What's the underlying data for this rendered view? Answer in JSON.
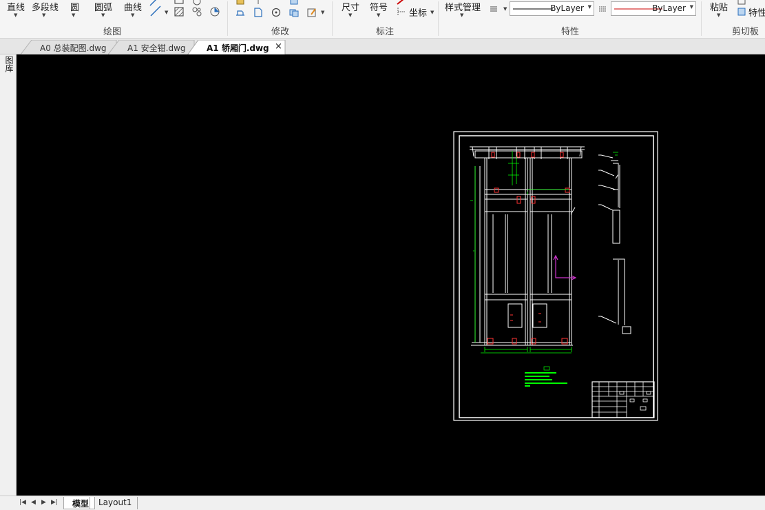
{
  "ribbon": {
    "draw_tools": {
      "line": "直线",
      "polyline": "多段线",
      "circle": "圆",
      "arc": "圆弧",
      "curve": "曲线"
    },
    "dimension_tools": {
      "dimension": "尺寸",
      "symbol": "符号",
      "coordinate": "坐标"
    },
    "style_manager": "样式管理",
    "properties": {
      "line_type": "ByLayer",
      "color_type": "ByLayer"
    },
    "clipboard": {
      "paste": "粘贴",
      "properties": "特性"
    },
    "panels": {
      "draw": "绘图",
      "modify": "修改",
      "annotate": "标注",
      "properties": "特性",
      "clipboard": "剪切板"
    }
  },
  "sidebar": {
    "label": "图库"
  },
  "tabs": [
    {
      "label": "A0 总装配图.dwg",
      "active": false
    },
    {
      "label": "A1 安全钳.dwg",
      "active": false
    },
    {
      "label": "A1 轿厢门.dwg",
      "active": true
    }
  ],
  "tab_close": "×",
  "layout_tabs": {
    "model": "模型",
    "layout1": "Layout1"
  },
  "colors": {
    "canvas": "#000000",
    "frame": "#ffffff",
    "dim": "#00ff00",
    "accent": "#ff3333",
    "ucs": "#cc33cc",
    "lineType": "#000000",
    "lineColor": "#cc0000"
  }
}
